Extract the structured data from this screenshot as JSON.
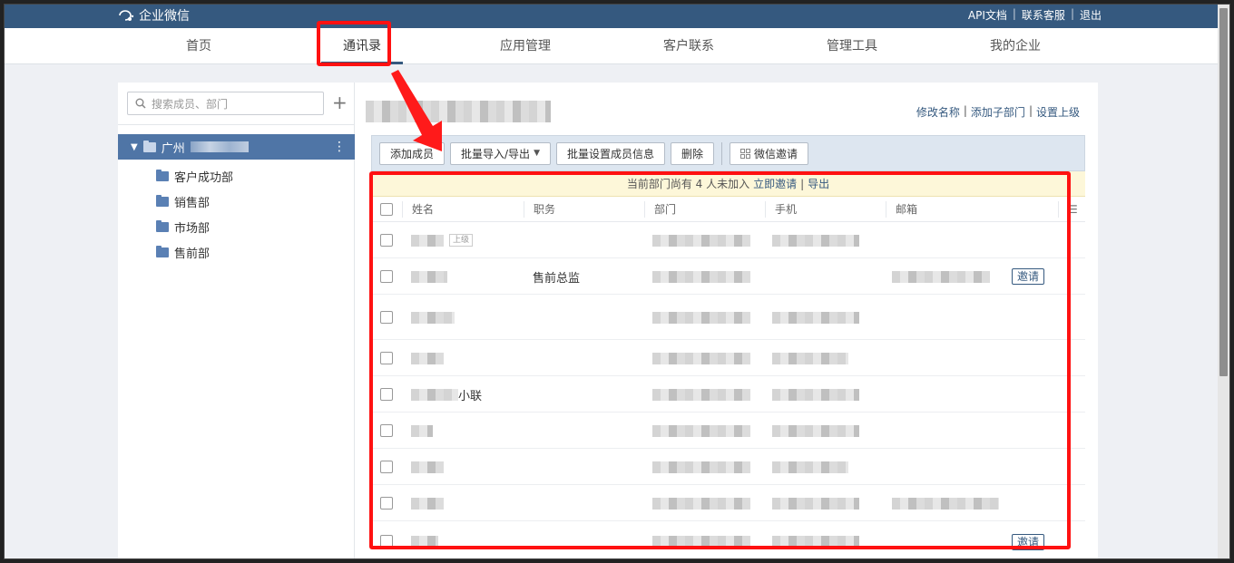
{
  "app": {
    "logo_text": "企业微信"
  },
  "top_links": [
    {
      "label": "API文档"
    },
    {
      "label": "联系客服"
    },
    {
      "label": "退出"
    }
  ],
  "nav": {
    "items": [
      {
        "label": "首页"
      },
      {
        "label": "通讯录",
        "active": true
      },
      {
        "label": "应用管理"
      },
      {
        "label": "客户联系"
      },
      {
        "label": "管理工具"
      },
      {
        "label": "我的企业"
      }
    ]
  },
  "sidebar": {
    "search_placeholder": "搜索成员、部门",
    "root_label": "广州",
    "children": [
      {
        "label": "客户成功部"
      },
      {
        "label": "销售部"
      },
      {
        "label": "市场部"
      },
      {
        "label": "售前部"
      }
    ]
  },
  "dept_links": [
    {
      "label": "修改名称"
    },
    {
      "label": "添加子部门"
    },
    {
      "label": "设置上级"
    }
  ],
  "toolbar": {
    "add_member": "添加成员",
    "batch_import_export": "批量导入/导出",
    "batch_set_info": "批量设置成员信息",
    "delete": "删除",
    "wechat_invite": "微信邀请"
  },
  "notice": {
    "text": "当前部门尚有 4 人未加入",
    "invite_link": "立即邀请",
    "separator": "|",
    "export_link": "导出"
  },
  "table": {
    "headers": [
      "姓名",
      "职务",
      "部门",
      "手机",
      "邮箱"
    ],
    "superior_tag": "上级",
    "rows": [
      {
        "title": "",
        "name_suffix": "",
        "superior": true,
        "invite": ""
      },
      {
        "title": "售前总监",
        "name_suffix": "",
        "superior": false,
        "invite": "邀请"
      },
      {
        "title": "",
        "name_suffix": "",
        "superior": false,
        "invite": ""
      },
      {
        "title": "",
        "name_suffix": "",
        "superior": false,
        "invite": ""
      },
      {
        "title": "",
        "name_suffix": "小联",
        "superior": false,
        "invite": ""
      },
      {
        "title": "",
        "name_suffix": "",
        "superior": false,
        "invite": ""
      },
      {
        "title": "",
        "name_suffix": "",
        "superior": false,
        "invite": ""
      },
      {
        "title": "",
        "name_suffix": "",
        "superior": false,
        "invite": ""
      },
      {
        "title": "",
        "name_suffix": "",
        "superior": false,
        "invite": "邀请"
      }
    ]
  },
  "colors": {
    "brand": "#35597f",
    "highlight": "#ff1111",
    "tree_active": "#4f75a6"
  }
}
